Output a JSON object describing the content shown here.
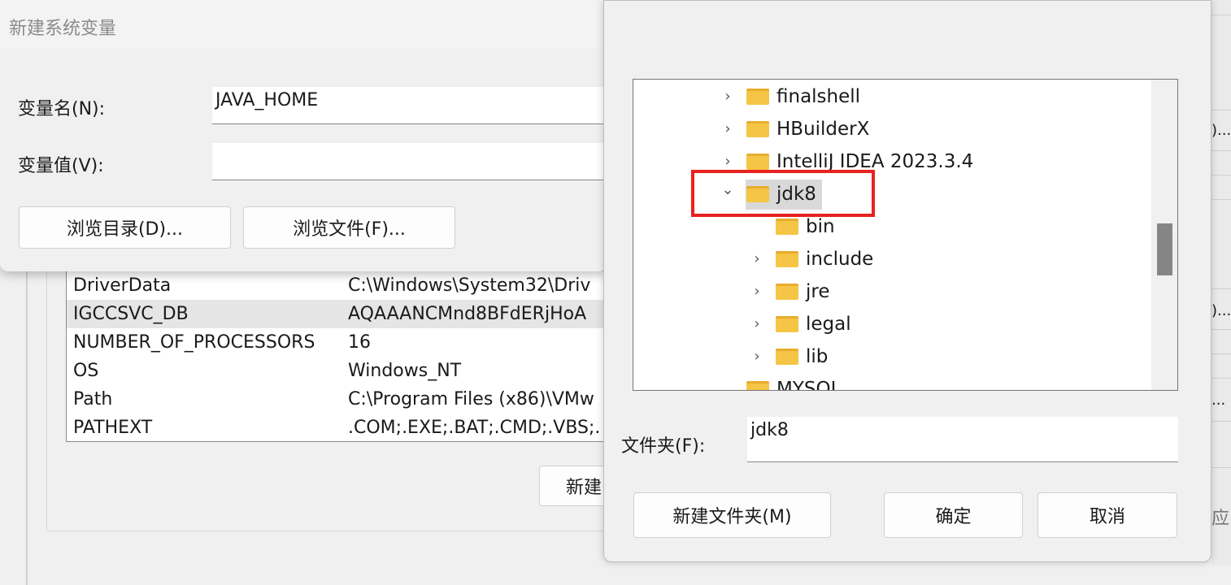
{
  "background_dialog": {
    "variables": [
      {
        "name": "DriverData",
        "value": "C:\\Windows\\System32\\Driv"
      },
      {
        "name": "IGCCSVC_DB",
        "value": "AQAAANCMnd8BFdERjHoA"
      },
      {
        "name": "NUMBER_OF_PROCESSORS",
        "value": "16"
      },
      {
        "name": "OS",
        "value": "Windows_NT"
      },
      {
        "name": "Path",
        "value": "C:\\Program Files (x86)\\VMw"
      },
      {
        "name": "PATHEXT",
        "value": ".COM;.EXE;.BAT;.CMD;.VBS;."
      }
    ],
    "selected_row": "IGCCSVC_DB",
    "new_button": "新建",
    "right_fragments": [
      ")...",
      ")...",
      "...",
      "应"
    ]
  },
  "new_var_dialog": {
    "title": "新建系统变量",
    "name_label": "变量名(N):",
    "name_value": "JAVA_HOME",
    "value_label": "变量值(V):",
    "value_value": "",
    "browse_dir": "浏览目录(D)...",
    "browse_file": "浏览文件(F)..."
  },
  "folder_dialog": {
    "tree": [
      {
        "label": "finalshell",
        "level": 0,
        "chevron": "right"
      },
      {
        "label": "HBuilderX",
        "level": 0,
        "chevron": "right"
      },
      {
        "label": "IntelliJ IDEA 2023.3.4",
        "level": 0,
        "chevron": "right"
      },
      {
        "label": "jdk8",
        "level": 0,
        "chevron": "down",
        "selected": true
      },
      {
        "label": "bin",
        "level": 1,
        "chevron": "none"
      },
      {
        "label": "include",
        "level": 1,
        "chevron": "right"
      },
      {
        "label": "jre",
        "level": 1,
        "chevron": "right"
      },
      {
        "label": "legal",
        "level": 1,
        "chevron": "right"
      },
      {
        "label": "lib",
        "level": 1,
        "chevron": "right"
      },
      {
        "label": "MYSQL",
        "level": 0,
        "chevron": "none"
      }
    ],
    "folder_label": "文件夹(F):",
    "folder_value": "jdk8",
    "new_folder": "新建文件夹(M)",
    "ok": "确定",
    "cancel": "取消",
    "highlight_color": "#e8221e"
  }
}
